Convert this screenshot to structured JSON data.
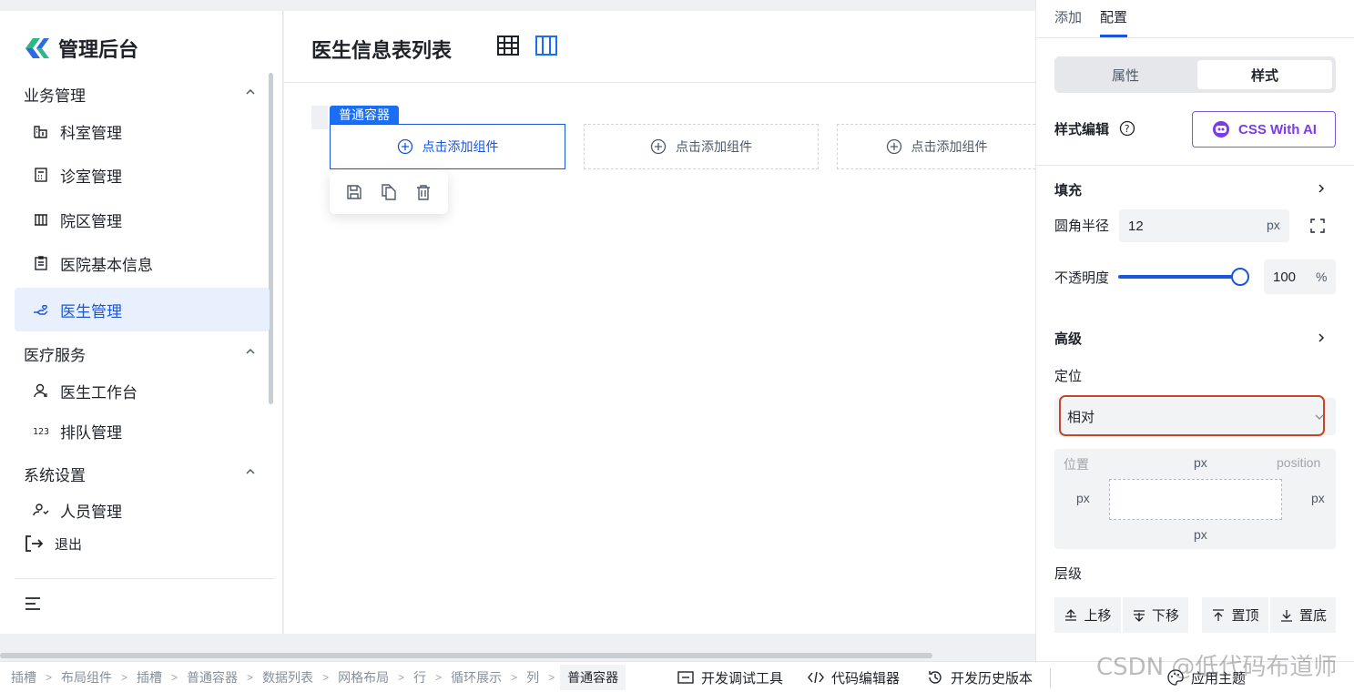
{
  "app": {
    "title": "管理后台"
  },
  "sidebar": {
    "groups": [
      {
        "title": "业务管理",
        "items": [
          "科室管理",
          "诊室管理",
          "院区管理",
          "医院基本信息",
          "医生管理"
        ]
      },
      {
        "title": "医疗服务",
        "items": [
          "医生工作台",
          "排队管理"
        ]
      },
      {
        "title": "系统设置",
        "items": [
          "人员管理"
        ]
      }
    ],
    "active_item": "医生管理",
    "logout": "退出"
  },
  "main": {
    "page_title": "医生信息表列表",
    "container_tag": "普通容器",
    "slots": [
      "点击添加组件",
      "点击添加组件",
      "点击添加组件"
    ]
  },
  "panel": {
    "tabs": [
      "添加",
      "配置"
    ],
    "active_tab": "配置",
    "segments": [
      "属性",
      "样式"
    ],
    "active_segment": "样式",
    "style_edit_label": "样式编辑",
    "ai_button": "CSS With AI",
    "fill_label": "填充",
    "radius_label": "圆角半径",
    "radius_value": "12",
    "radius_unit": "px",
    "opacity_label": "不透明度",
    "opacity_value": "100",
    "opacity_unit": "%",
    "opacity_level": 1.0,
    "advanced_label": "高级",
    "position_label": "定位",
    "position_value": "相对",
    "pos_box": {
      "title": "位置",
      "right_title": "position",
      "top": "px",
      "left": "px",
      "right": "px",
      "bottom": "px"
    },
    "layer_label": "层级",
    "layer_buttons": [
      "上移",
      "下移",
      "置顶",
      "置底"
    ]
  },
  "bottom": {
    "breadcrumbs": [
      "插槽",
      "布局组件",
      "插槽",
      "普通容器",
      "数据列表",
      "网格布局",
      "行",
      "循环展示",
      "列",
      "普通容器"
    ],
    "tools": [
      "开发调试工具",
      "代码编辑器",
      "开发历史版本",
      "应用主题"
    ]
  },
  "watermark": "CSDN @低代码布道师",
  "colors": {
    "accent": "#1a56db",
    "tag": "#1a6ef5",
    "ai": "#7c3aed",
    "highlight": "#c8442a"
  }
}
